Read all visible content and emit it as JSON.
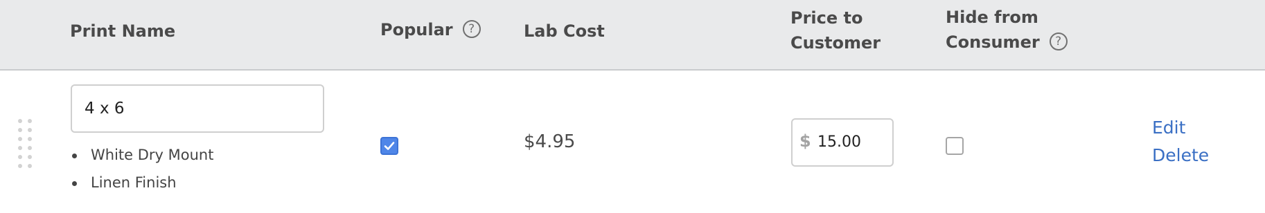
{
  "header": {
    "print_name": "Print Name",
    "popular": "Popular",
    "lab_cost": "Lab Cost",
    "price_line1": "Price to",
    "price_line2": "Customer",
    "hide_line1": "Hide from",
    "hide_line2": "Consumer",
    "help_glyph": "?"
  },
  "row": {
    "print_name_value": "4 x 6",
    "options": [
      "White Dry Mount",
      "Linen Finish"
    ],
    "popular_checked": true,
    "lab_cost": "$4.95",
    "currency_symbol": "$",
    "price_value": "15.00",
    "hide_checked": false,
    "edit_label": "Edit",
    "delete_label": "Delete"
  },
  "icons": {
    "drag": "drag-handle-icon",
    "help": "question-circle-icon",
    "check": "checkmark-icon"
  },
  "colors": {
    "header_bg": "#e9eaeb",
    "accent": "#4f86e8",
    "link": "#3a6fc4"
  }
}
